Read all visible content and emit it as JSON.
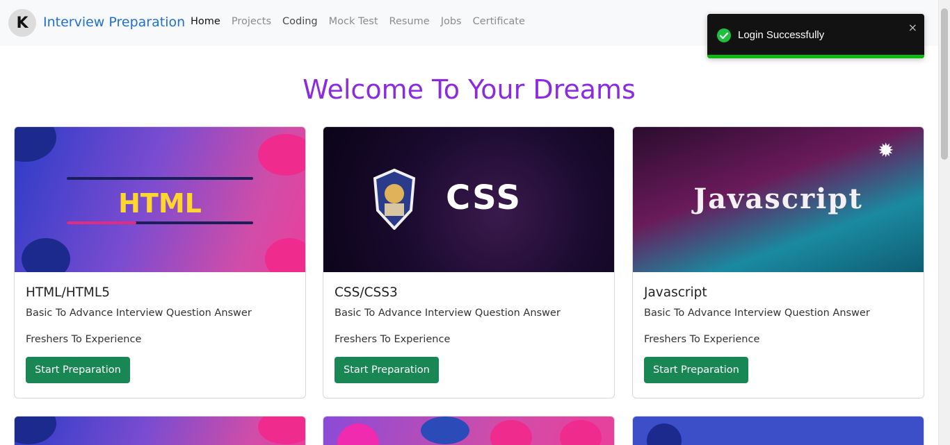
{
  "brand": {
    "logo_letter": "K",
    "name": "Interview Preparation"
  },
  "nav": [
    "Home",
    "Projects",
    "Coding",
    "Mock Test",
    "Resume",
    "Jobs",
    "Certificate"
  ],
  "heading": "Welcome To Your Dreams",
  "cards": [
    {
      "banner": "HTML",
      "title": "HTML/HTML5",
      "line1": "Basic To Advance Interview Question Answer",
      "line2": "Freshers To Experience",
      "button": "Start Preparation"
    },
    {
      "banner": "CSS",
      "title": "CSS/CSS3",
      "line1": "Basic To Advance Interview Question Answer",
      "line2": "Freshers To Experience",
      "button": "Start Preparation"
    },
    {
      "banner": "Javascript",
      "title": "Javascript",
      "line1": "Basic To Advance Interview Question Answer",
      "line2": "Freshers To Experience",
      "button": "Start Preparation"
    }
  ],
  "toast": {
    "message": "Login Successfully",
    "close": "×",
    "icon": "check-circle-icon",
    "color": "#07bc0c"
  },
  "colors": {
    "accent": "#8a2be2",
    "brand": "#1f6fd6",
    "button": "#198754"
  }
}
